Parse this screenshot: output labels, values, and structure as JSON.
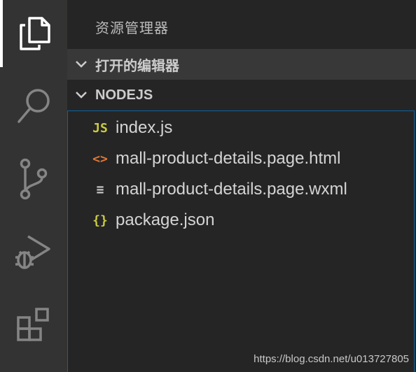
{
  "sidebar": {
    "title": "资源管理器",
    "sections": {
      "open_editors": "打开的编辑器",
      "workspace": "NODEJS"
    },
    "files": [
      {
        "name": "index.js",
        "icon_label": "JS",
        "icon": "js-file-icon",
        "color": "#cbcb41"
      },
      {
        "name": "mall-product-details.page.html",
        "icon_label": "<>",
        "icon": "html-file-icon",
        "color": "#e37933"
      },
      {
        "name": "mall-product-details.page.wxml",
        "icon_label": "≡",
        "icon": "text-file-icon",
        "color": "#cccccc"
      },
      {
        "name": "package.json",
        "icon_label": "{}",
        "icon": "json-file-icon",
        "color": "#cbcb41"
      }
    ]
  },
  "activity_bar": [
    "files-icon",
    "search-icon",
    "source-control-icon",
    "run-debug-icon",
    "extensions-icon"
  ],
  "watermark": "https://blog.csdn.net/u013727805"
}
